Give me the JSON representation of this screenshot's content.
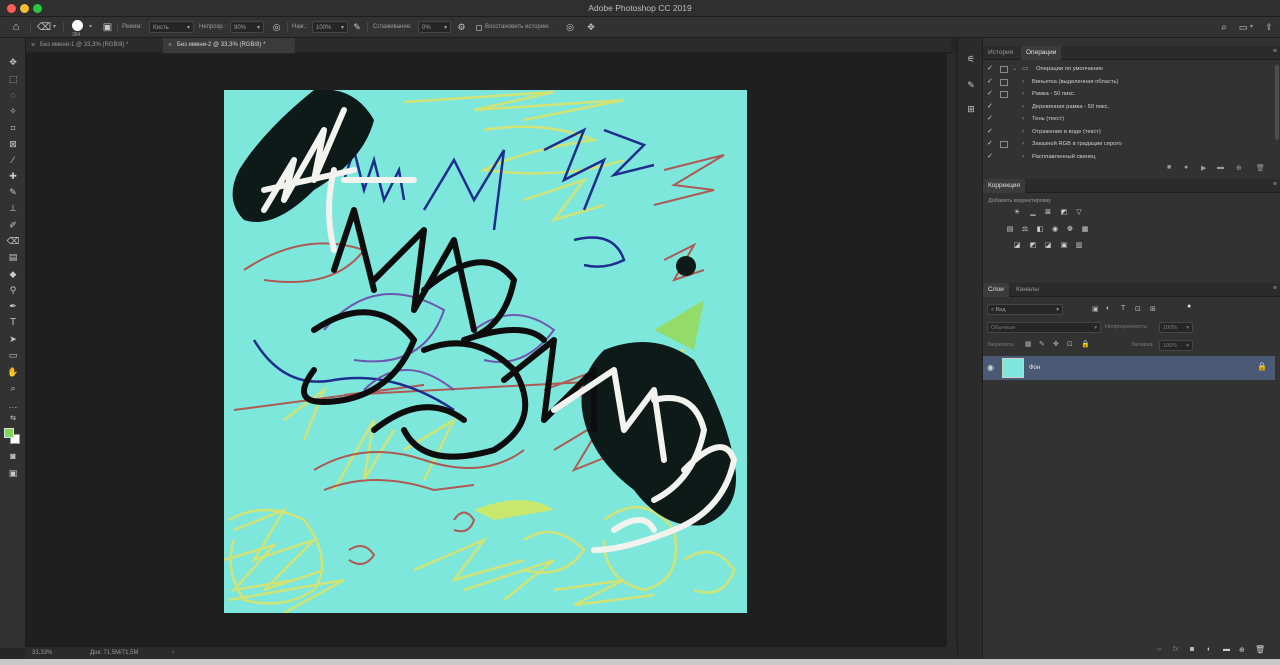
{
  "app": {
    "title": "Adobe Photoshop CC 2019"
  },
  "options_bar": {
    "brush_size": "384",
    "mode_label": "Режим:",
    "mode_value": "Кисть",
    "opacity_label": "Непрозр.:",
    "opacity_value": "90%",
    "flow_label": "Наж.:",
    "flow_value": "100%",
    "smoothing_label": "Сглаживание:",
    "smoothing_value": "0%",
    "history_checkbox_label": "Восстановить историю"
  },
  "documents": {
    "tabs": [
      {
        "label": "Без имени-1 @ 33,3% (RGB/8) *"
      },
      {
        "label": "Без имени-2 @ 33,3% (RGB/8) *"
      }
    ]
  },
  "status": {
    "zoom": "33,33%",
    "doc": "Док: 71,5M/71,5M"
  },
  "history_panel": {
    "tabs": [
      "История",
      "Операции"
    ],
    "rows": [
      {
        "label": "Операции по умолчанию",
        "type": "folder"
      },
      {
        "label": "Виньетка (выделенная область)",
        "type": "action"
      },
      {
        "label": "Рамка - 50 пикс.",
        "type": "action"
      },
      {
        "label": "Деревянная рамка - 50 пикс.",
        "type": "action"
      },
      {
        "label": "Тень (текст)",
        "type": "action"
      },
      {
        "label": "Отражение в воде (текст)",
        "type": "action"
      },
      {
        "label": "Заказной RGB в градации серого",
        "type": "action"
      },
      {
        "label": "Расплавленный свинец",
        "type": "action"
      }
    ]
  },
  "adjustments_panel": {
    "tab": "Коррекция",
    "label": "Добавить корректировку"
  },
  "layers_panel": {
    "tabs": [
      "Слои",
      "Каналы"
    ],
    "filter_placeholder": "Вид",
    "blend_mode": "Обычные",
    "opacity_label": "Непрозрачность:",
    "opacity_value": "100%",
    "lock_label": "Закрепить:",
    "fill_label": "Заливка:",
    "fill_value": "100%",
    "layers": [
      {
        "name": "Фон"
      }
    ]
  },
  "colors": {
    "foreground": "#7ed957",
    "background": "#ffffff",
    "canvas": "#7ee7dc",
    "selected_layer": "#4a5a75"
  }
}
